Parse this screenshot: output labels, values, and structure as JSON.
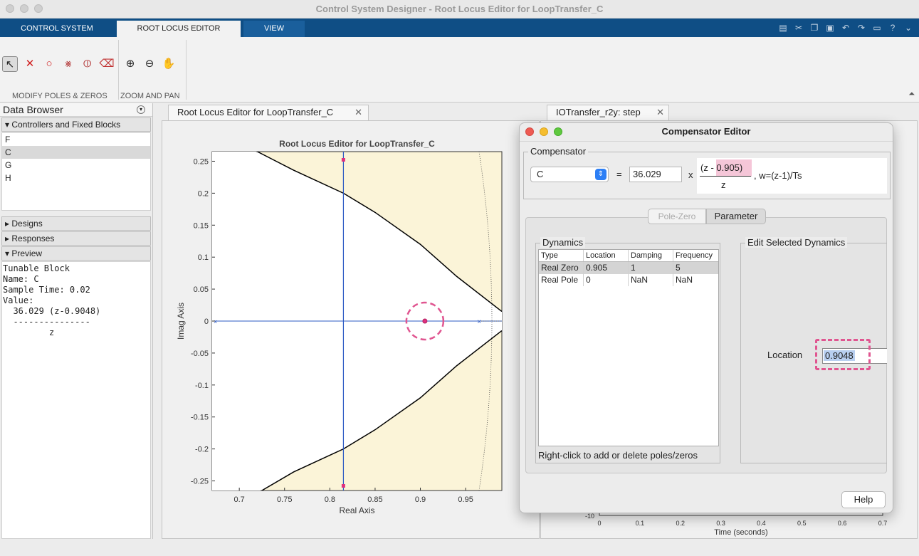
{
  "window": {
    "title": "Control System Designer - Root Locus Editor for LoopTransfer_C"
  },
  "ribbon": {
    "tabs": [
      "CONTROL SYSTEM",
      "ROOT LOCUS EDITOR",
      "VIEW"
    ],
    "groups": [
      "MODIFY POLES & ZEROS",
      "ZOOM AND PAN"
    ]
  },
  "data_browser": {
    "title": "Data Browser",
    "section_blocks": "Controllers and Fixed Blocks",
    "blocks": [
      "F",
      "C",
      "G",
      "H"
    ],
    "selected_block": "C",
    "section_designs": "Designs",
    "section_responses": "Responses",
    "section_preview": "Preview",
    "preview_lines": [
      "Tunable Block",
      "Name: C",
      "Sample Time: 0.02",
      "Value:",
      "  36.029 (z-0.9048)",
      "  ---------------",
      "         z"
    ]
  },
  "documents": {
    "left_tab": "Root Locus Editor for LoopTransfer_C",
    "right_tab": "IOTransfer_r2y: step"
  },
  "chart_data": {
    "type": "scatter",
    "title": "Root Locus Editor for LoopTransfer_C",
    "xlabel": "Real Axis",
    "ylabel": "Imag Axis",
    "xlim": [
      0.67,
      0.99
    ],
    "ylim": [
      -0.265,
      0.265
    ],
    "xticks": [
      "0.7",
      "0.75",
      "0.8",
      "0.85",
      "0.9",
      "0.95"
    ],
    "xtick_values": [
      0.7,
      0.75,
      0.8,
      0.85,
      0.9,
      0.95
    ],
    "yticks": [
      "0.25",
      "0.2",
      "0.15",
      "0.1",
      "0.05",
      "0",
      "-0.05",
      "-0.1",
      "-0.15",
      "-0.2",
      "-0.25"
    ],
    "ytick_values": [
      0.25,
      0.2,
      0.15,
      0.1,
      0.05,
      0,
      -0.05,
      -0.1,
      -0.15,
      -0.2,
      -0.25
    ],
    "zero": [
      0.905,
      0
    ],
    "closed_loop_markers_x": 0.815,
    "pole_marker": [
      0.965,
      0
    ],
    "locus_upper": [
      [
        0.69,
        0.28
      ],
      [
        0.72,
        0.265
      ],
      [
        0.76,
        0.236
      ],
      [
        0.815,
        0.2
      ],
      [
        0.85,
        0.17
      ],
      [
        0.9,
        0.12
      ],
      [
        0.94,
        0.07
      ],
      [
        0.99,
        0.015
      ]
    ],
    "locus_lower": [
      [
        0.69,
        -0.28
      ],
      [
        0.725,
        -0.265
      ],
      [
        0.76,
        -0.236
      ],
      [
        0.815,
        -0.2
      ],
      [
        0.85,
        -0.17
      ],
      [
        0.9,
        -0.12
      ],
      [
        0.94,
        -0.07
      ],
      [
        0.99,
        -0.015
      ]
    ],
    "colors": {
      "stable_region": "#fbf4d8",
      "locus": "#000000",
      "axis_line": "#2b59c3",
      "marker": "#e0317e",
      "highlight": "#e05590"
    }
  },
  "compensator_editor": {
    "title": "Compensator Editor",
    "section": "Compensator",
    "block": "C",
    "equals": "=",
    "gain": "36.029",
    "times": "x",
    "numerator": "(z - 0.905)",
    "denominator": "z",
    "suffix": ", w=(z-1)/Ts",
    "tabs": [
      "Pole-Zero",
      "Parameter"
    ],
    "dynamics_label": "Dynamics",
    "columns": [
      "Type",
      "Location",
      "Damping",
      "Frequency"
    ],
    "rows": [
      [
        "Real Zero",
        "0.905",
        "1",
        "5"
      ],
      [
        "Real Pole",
        "0",
        "NaN",
        "NaN"
      ]
    ],
    "hint": "Right-click to add or delete poles/zeros",
    "edit_label": "Edit Selected Dynamics",
    "location_label": "Location",
    "location_value": "0.9048",
    "help": "Help"
  },
  "step_plot": {
    "xlabel": "Time (seconds)",
    "xticks": [
      "0",
      "0.1",
      "0.2",
      "0.3",
      "0.4",
      "0.5",
      "0.6",
      "0.7"
    ],
    "ytick_partial": "-10"
  }
}
